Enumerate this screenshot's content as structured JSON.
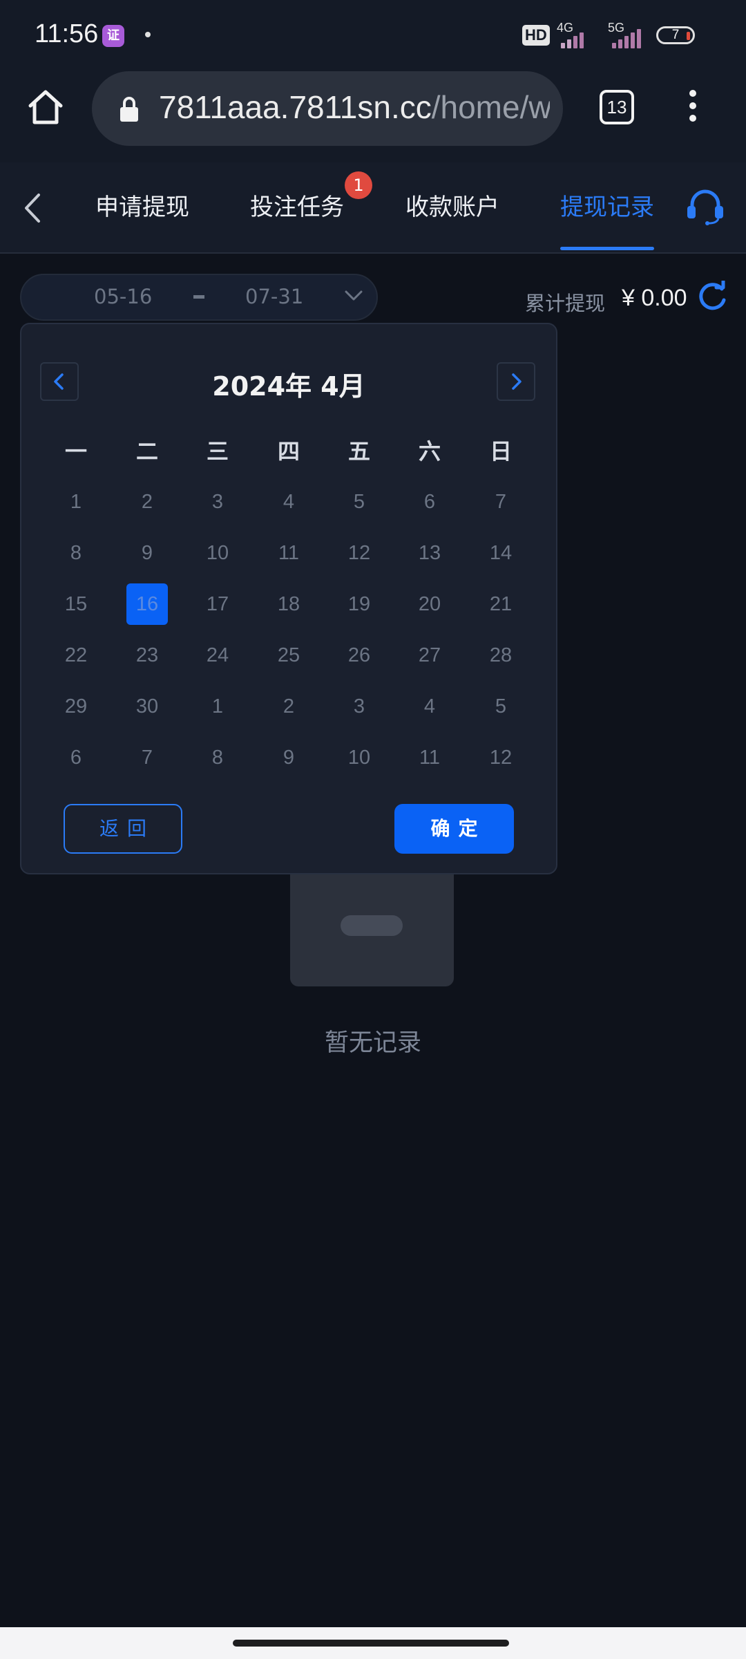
{
  "status_bar": {
    "time": "11:56",
    "app_icon": "app-notification-icon",
    "hd": "HD",
    "net1": "4G",
    "net2": "5G",
    "battery": "7"
  },
  "browser": {
    "url_host": "7811aaa.7811sn.cc",
    "url_path": "/home/wit",
    "tab_count": "13"
  },
  "nav": {
    "tabs": [
      {
        "label": "申请提现"
      },
      {
        "label": "投注任务",
        "badge": "1"
      },
      {
        "label": "收款账户"
      },
      {
        "label": "提现记录",
        "active": true
      }
    ]
  },
  "filter": {
    "start": "05-16",
    "end": "07-31",
    "total_label": "累计提现",
    "total_value": "¥ 0.00"
  },
  "calendar": {
    "title": "2024年 4月",
    "weekdays": [
      "一",
      "二",
      "三",
      "四",
      "五",
      "六",
      "日"
    ],
    "weeks": [
      [
        "1",
        "2",
        "3",
        "4",
        "5",
        "6",
        "7"
      ],
      [
        "8",
        "9",
        "10",
        "11",
        "12",
        "13",
        "14"
      ],
      [
        "15",
        "16",
        "17",
        "18",
        "19",
        "20",
        "21"
      ],
      [
        "22",
        "23",
        "24",
        "25",
        "26",
        "27",
        "28"
      ],
      [
        "29",
        "30",
        "1",
        "2",
        "3",
        "4",
        "5"
      ],
      [
        "6",
        "7",
        "8",
        "9",
        "10",
        "11",
        "12"
      ]
    ],
    "selected": "16",
    "back_label": "返回",
    "ok_label": "确定"
  },
  "empty": {
    "text": "暂无记录"
  },
  "colors": {
    "accent": "#2b7bf6",
    "background": "#0e121b",
    "badge": "#e04a3f"
  }
}
